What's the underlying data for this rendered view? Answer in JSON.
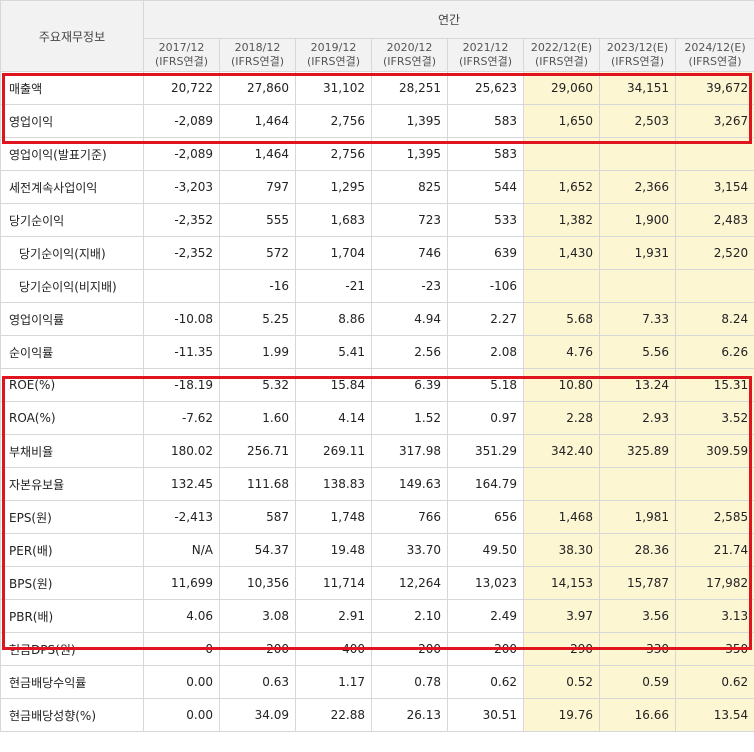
{
  "header": {
    "title": "주요재무정보",
    "period_group": "연간",
    "columns": [
      {
        "date": "2017/12",
        "basis": "(IFRS연결)",
        "estimate": false
      },
      {
        "date": "2018/12",
        "basis": "(IFRS연결)",
        "estimate": false
      },
      {
        "date": "2019/12",
        "basis": "(IFRS연결)",
        "estimate": false
      },
      {
        "date": "2020/12",
        "basis": "(IFRS연결)",
        "estimate": false
      },
      {
        "date": "2021/12",
        "basis": "(IFRS연결)",
        "estimate": false
      },
      {
        "date": "2022/12(E)",
        "basis": "(IFRS연결)",
        "estimate": true
      },
      {
        "date": "2023/12(E)",
        "basis": "(IFRS연결)",
        "estimate": true
      },
      {
        "date": "2024/12(E)",
        "basis": "(IFRS연결)",
        "estimate": true
      }
    ]
  },
  "rows": [
    {
      "label": "매출액",
      "indent": false,
      "values": [
        "20,722",
        "27,860",
        "31,102",
        "28,251",
        "25,623",
        "29,060",
        "34,151",
        "39,672"
      ]
    },
    {
      "label": "영업이익",
      "indent": false,
      "values": [
        "-2,089",
        "1,464",
        "2,756",
        "1,395",
        "583",
        "1,650",
        "2,503",
        "3,267"
      ]
    },
    {
      "label": "영업이익(발표기준)",
      "indent": false,
      "values": [
        "-2,089",
        "1,464",
        "2,756",
        "1,395",
        "583",
        "",
        "",
        ""
      ]
    },
    {
      "label": "세전계속사업이익",
      "indent": false,
      "values": [
        "-3,203",
        "797",
        "1,295",
        "825",
        "544",
        "1,652",
        "2,366",
        "3,154"
      ]
    },
    {
      "label": "당기순이익",
      "indent": false,
      "values": [
        "-2,352",
        "555",
        "1,683",
        "723",
        "533",
        "1,382",
        "1,900",
        "2,483"
      ]
    },
    {
      "label": "당기순이익(지배)",
      "indent": true,
      "values": [
        "-2,352",
        "572",
        "1,704",
        "746",
        "639",
        "1,430",
        "1,931",
        "2,520"
      ]
    },
    {
      "label": "당기순이익(비지배)",
      "indent": true,
      "values": [
        "",
        "-16",
        "-21",
        "-23",
        "-106",
        "",
        "",
        ""
      ]
    },
    {
      "label": "영업이익률",
      "indent": false,
      "values": [
        "-10.08",
        "5.25",
        "8.86",
        "4.94",
        "2.27",
        "5.68",
        "7.33",
        "8.24"
      ]
    },
    {
      "label": "순이익률",
      "indent": false,
      "values": [
        "-11.35",
        "1.99",
        "5.41",
        "2.56",
        "2.08",
        "4.76",
        "5.56",
        "6.26"
      ]
    },
    {
      "label": "ROE(%)",
      "indent": false,
      "values": [
        "-18.19",
        "5.32",
        "15.84",
        "6.39",
        "5.18",
        "10.80",
        "13.24",
        "15.31"
      ]
    },
    {
      "label": "ROA(%)",
      "indent": false,
      "values": [
        "-7.62",
        "1.60",
        "4.14",
        "1.52",
        "0.97",
        "2.28",
        "2.93",
        "3.52"
      ]
    },
    {
      "label": "부채비율",
      "indent": false,
      "values": [
        "180.02",
        "256.71",
        "269.11",
        "317.98",
        "351.29",
        "342.40",
        "325.89",
        "309.59"
      ]
    },
    {
      "label": "자본유보율",
      "indent": false,
      "values": [
        "132.45",
        "111.68",
        "138.83",
        "149.63",
        "164.79",
        "",
        "",
        ""
      ]
    },
    {
      "label": "EPS(원)",
      "indent": false,
      "values": [
        "-2,413",
        "587",
        "1,748",
        "766",
        "656",
        "1,468",
        "1,981",
        "2,585"
      ]
    },
    {
      "label": "PER(배)",
      "indent": false,
      "values": [
        "N/A",
        "54.37",
        "19.48",
        "33.70",
        "49.50",
        "38.30",
        "28.36",
        "21.74"
      ]
    },
    {
      "label": "BPS(원)",
      "indent": false,
      "values": [
        "11,699",
        "10,356",
        "11,714",
        "12,264",
        "13,023",
        "14,153",
        "15,787",
        "17,982"
      ]
    },
    {
      "label": "PBR(배)",
      "indent": false,
      "values": [
        "4.06",
        "3.08",
        "2.91",
        "2.10",
        "2.49",
        "3.97",
        "3.56",
        "3.13"
      ]
    },
    {
      "label": "현금DPS(원)",
      "indent": false,
      "values": [
        "0",
        "200",
        "400",
        "200",
        "200",
        "290",
        "330",
        "350"
      ]
    },
    {
      "label": "현금배당수익률",
      "indent": false,
      "values": [
        "0.00",
        "0.63",
        "1.17",
        "0.78",
        "0.62",
        "0.52",
        "0.59",
        "0.62"
      ]
    },
    {
      "label": "현금배당성향(%)",
      "indent": false,
      "values": [
        "0.00",
        "34.09",
        "22.88",
        "26.13",
        "30.51",
        "19.76",
        "16.66",
        "13.54"
      ]
    }
  ],
  "colors": {
    "negative": "#d0021b",
    "estimate_bg": "#fdf6d3",
    "highlight_box": "#e0141e",
    "header_bg": "#f2f2f2"
  }
}
